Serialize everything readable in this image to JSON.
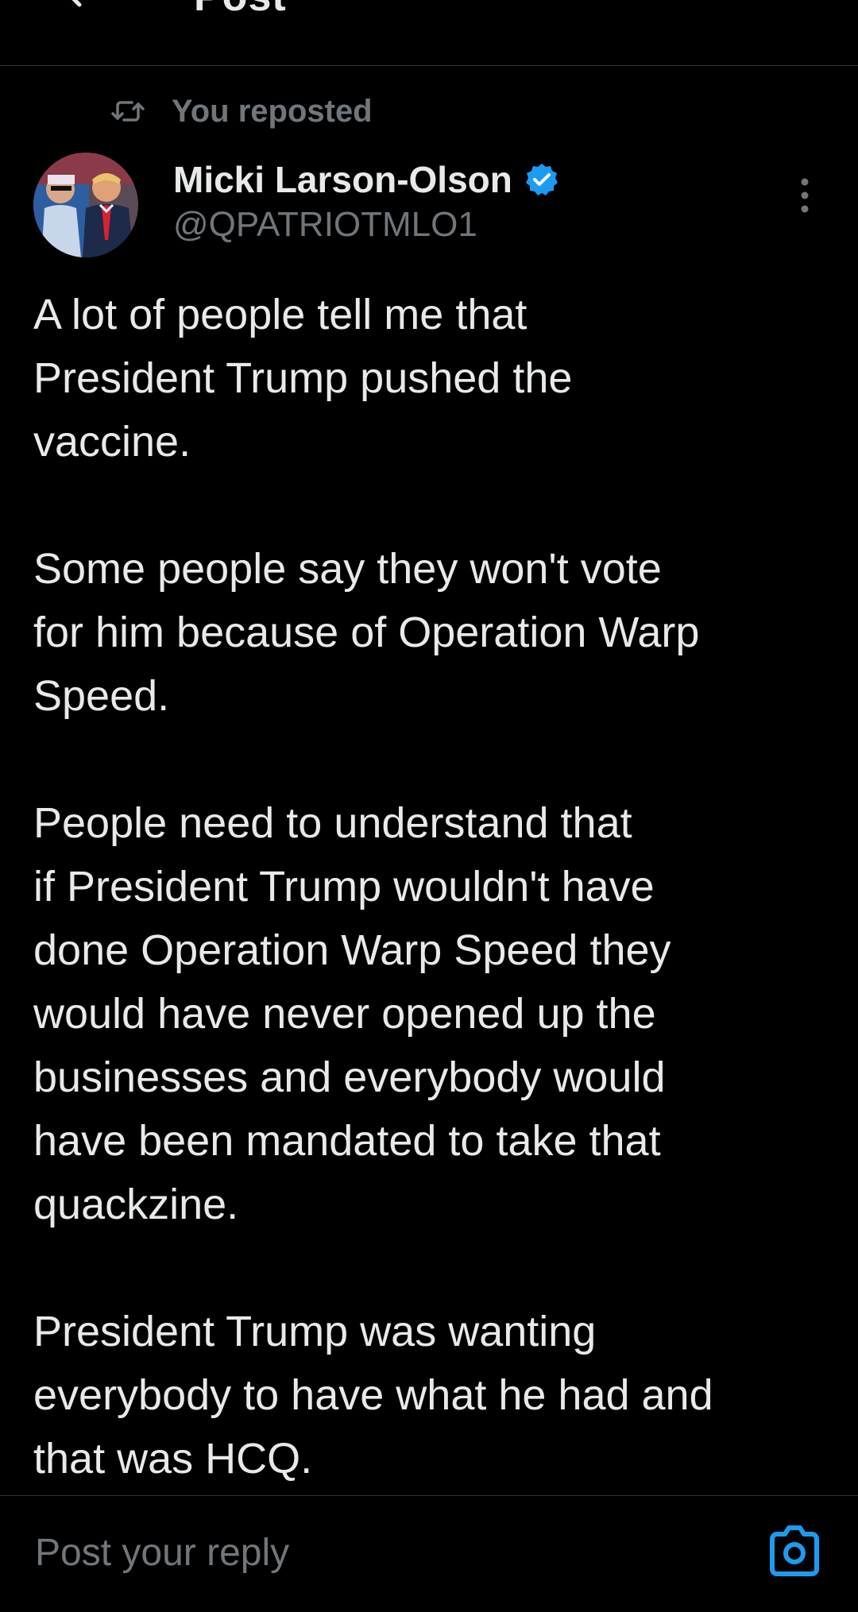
{
  "header": {
    "title": "Post"
  },
  "repost": {
    "label": "You reposted"
  },
  "author": {
    "display_name": "Micki Larson-Olson",
    "handle": "@QPATRIOTMLO1",
    "verified_color": "#1d9bf0"
  },
  "post": {
    "paragraphs": [
      [
        "A lot of people tell me that",
        "President Trump pushed the",
        "vaccine."
      ],
      [
        "Some people say they won't vote",
        "for him because of Operation Warp",
        "Speed."
      ],
      [
        "People need to understand that",
        "if President Trump wouldn't have",
        "done Operation Warp Speed they",
        "would have never opened up the",
        "businesses and everybody would",
        "have been mandated to take that",
        "quackzine."
      ],
      [
        "President Trump was wanting",
        "everybody to have what he had and",
        "that was HCQ."
      ]
    ]
  },
  "reply": {
    "placeholder": "Post your reply"
  },
  "icons": {
    "back": "back-arrow-icon",
    "repost": "repost-icon",
    "verified": "verified-badge-icon",
    "more": "more-vertical-icon",
    "camera": "camera-icon"
  },
  "colors": {
    "background": "#000000",
    "text": "#e7e9ea",
    "secondary_text": "#71767b",
    "accent": "#1d9bf0",
    "divider": "#2f3336"
  }
}
